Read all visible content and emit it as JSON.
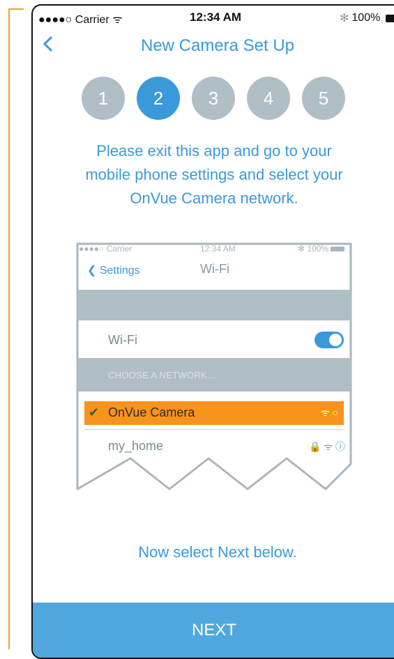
{
  "status_bar": {
    "carrier": "●●●●○ Carrier",
    "time": "12:34 AM",
    "battery": "100%"
  },
  "nav": {
    "title": "New Camera Set Up",
    "back_icon": "chevron-left-icon"
  },
  "steps": [
    {
      "label": "1",
      "active": false
    },
    {
      "label": "2",
      "active": true
    },
    {
      "label": "3",
      "active": false
    },
    {
      "label": "4",
      "active": false
    },
    {
      "label": "5",
      "active": false
    }
  ],
  "instructions": "Please  exit this app and go to your mobile phone settings and select your OnVue Camera network.",
  "illustration": {
    "status_bar": {
      "carrier": "●●●●○ Carrier",
      "time": "12:34 AM",
      "battery": "100%"
    },
    "back_label": "Settings",
    "title": "Wi-Fi",
    "wifi_label": "Wi-Fi",
    "wifi_on": true,
    "section_label": "CHOOSE A NETWORK...",
    "networks": [
      {
        "name": "OnVue Camera",
        "selected": true
      },
      {
        "name": "my_home",
        "selected": false,
        "locked": true
      }
    ]
  },
  "bottom_text": "Now select Next below.",
  "next_button": {
    "label": "NEXT"
  },
  "colors": {
    "accent": "#3a9ad9",
    "button": "#4fa7de",
    "highlight": "#f7941d",
    "inactive": "#b0bec5"
  }
}
